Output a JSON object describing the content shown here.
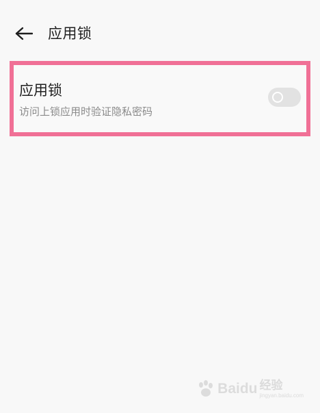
{
  "header": {
    "title": "应用锁",
    "back_icon": "arrow-left-icon"
  },
  "setting": {
    "title": "应用锁",
    "subtitle": "访问上锁应用时验证隐私密码",
    "toggle_state": "off"
  },
  "watermark": {
    "brand": "Bai",
    "brand_suffix": "du",
    "label": "经验",
    "url": "jingyan.baidu.com"
  },
  "colors": {
    "highlight_border": "#f07096",
    "background": "#f8f8f8",
    "toggle_track": "#e2e2e2"
  }
}
